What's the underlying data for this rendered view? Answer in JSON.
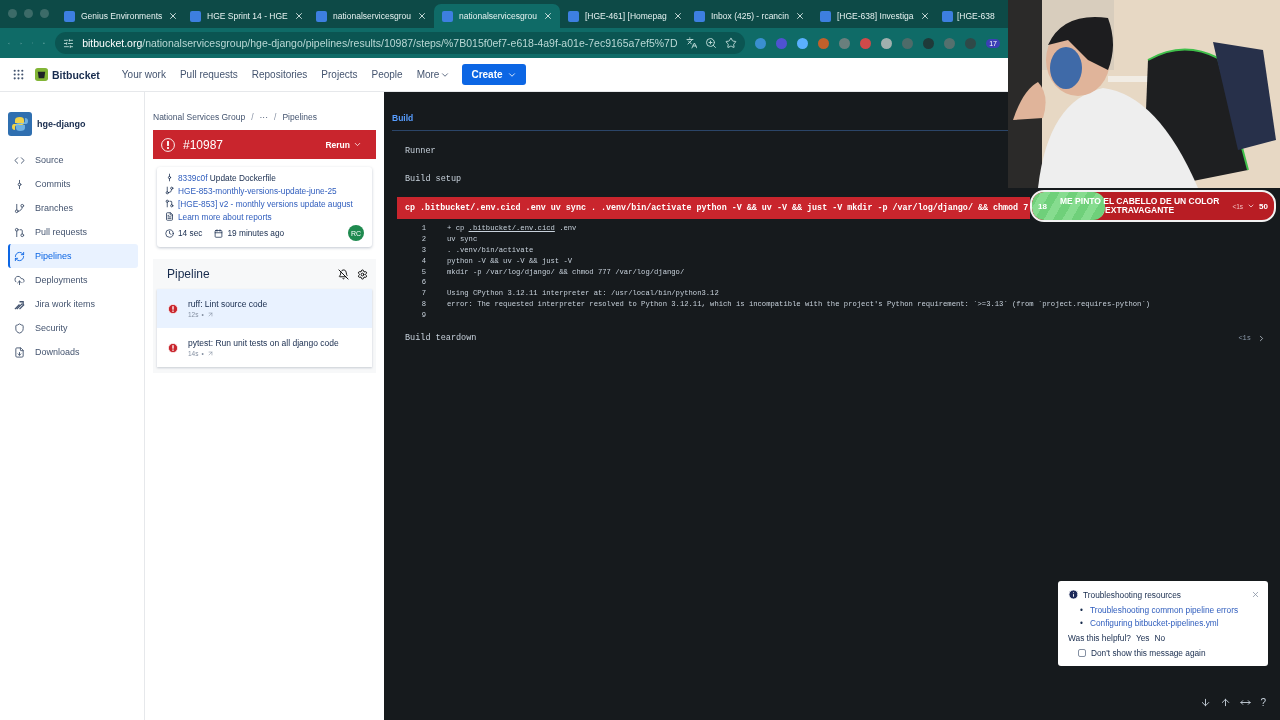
{
  "browser": {
    "tabs": [
      {
        "title": "Genius Environments",
        "selected": false
      },
      {
        "title": "HGE Sprint 14 - HGE",
        "selected": false
      },
      {
        "title": "nationalservicesgrou",
        "selected": false
      },
      {
        "title": "nationalservicesgrou",
        "selected": true
      },
      {
        "title": "[HGE-461] [Homepag",
        "selected": false
      },
      {
        "title": "Inbox (425) - rcancin",
        "selected": false
      },
      {
        "title": "[HGE-638] Investiga",
        "selected": false
      },
      {
        "title": "[HGE-638",
        "selected": false
      }
    ],
    "url_host": "bitbucket.org",
    "url_path": "/nationalservicesgroup/hge-django/pipelines/results/10987/steps/%7B015f0ef7-e618-4a9f-a01e-7ec9165a7ef5%7D",
    "extension_badge": "17"
  },
  "header": {
    "product": "Bitbucket",
    "nav": [
      "Your work",
      "Pull requests",
      "Repositories",
      "Projects",
      "People",
      "More"
    ],
    "create": "Create"
  },
  "repo": {
    "name": "hge-django"
  },
  "sidebar": {
    "items": [
      {
        "label": "Source",
        "selected": false
      },
      {
        "label": "Commits",
        "selected": false
      },
      {
        "label": "Branches",
        "selected": false
      },
      {
        "label": "Pull requests",
        "selected": false
      },
      {
        "label": "Pipelines",
        "selected": true
      },
      {
        "label": "Deployments",
        "selected": false
      },
      {
        "label": "Jira work items",
        "selected": false
      },
      {
        "label": "Security",
        "selected": false
      },
      {
        "label": "Downloads",
        "selected": false
      }
    ]
  },
  "breadcrumb": [
    {
      "kind": "link",
      "text": "National Services Group"
    },
    {
      "kind": "separator",
      "text": "/"
    },
    {
      "kind": "link",
      "text": "···"
    },
    {
      "kind": "separator",
      "text": "/"
    },
    {
      "kind": "link",
      "text": "Pipelines"
    }
  ],
  "run": {
    "number": "#10987",
    "failed": true,
    "rerun": "Rerun",
    "commit_hash": "8339c0f",
    "commit_message": "Update Dockerfile",
    "branch": "HGE-853-monthly-versions-update-june-25",
    "pull_request": "[HGE-853] v2 - monthly versions update august",
    "reports_link": "Learn more about reports",
    "duration": "14 sec",
    "time": "19 minutes ago",
    "avatar": "RC"
  },
  "pipeline": {
    "title": "Pipeline",
    "steps": [
      {
        "name": "ruff: Lint source code",
        "duration": "12s",
        "separator": "•",
        "failed": true,
        "selected": true
      },
      {
        "name": "pytest: Run unit tests on all django code",
        "duration": "14s",
        "separator": "•",
        "failed": true,
        "selected": false
      }
    ]
  },
  "log": {
    "tab": "Build",
    "sections": [
      "Runner",
      "Build setup"
    ],
    "command": {
      "text": "cp .bitbucket/.env.cicd .env uv sync . .venv/bin/activate python -V && uv -V && just -V mkdir -p /var/log/django/ && chmod 7",
      "failed": true
    },
    "lines": [
      {
        "number": "1",
        "text": "+ cp ",
        "link": ".bitbucket/.env.cicd",
        "suffix": " .env"
      },
      {
        "number": "2",
        "text": "uv sync"
      },
      {
        "number": "3",
        "text": ". .venv/bin/activate"
      },
      {
        "number": "4",
        "text": "python -V && uv -V && just -V"
      },
      {
        "number": "5",
        "text": "mkdir -p /var/log/django/ && chmod 777 /var/log/django/"
      },
      {
        "number": "6"
      },
      {
        "number": "7",
        "text": "Using CPython 3.12.11 interpreter at: /usr/local/bin/python3.12"
      },
      {
        "number": "8",
        "text": "error: The requested interpreter resolved to Python 3.12.11, which is incompatible with the project's Python requirement: `>=3.13` (from `project.requires-python`)"
      },
      {
        "number": "9"
      }
    ],
    "teardown": {
      "title": "Build teardown",
      "duration": "<1s"
    },
    "help": "?"
  },
  "stream_overlay": {
    "start": "18",
    "title": "ME PINTO EL CABELLO DE UN COLOR EXTRAVAGANTE",
    "note": "<1s",
    "end": "50",
    "level": 0.3
  },
  "toast": {
    "title": "Troubleshooting resources",
    "links": [
      {
        "bullet": "•",
        "text": "Troubleshooting common pipeline errors"
      },
      {
        "bullet": "•",
        "text": "Configuring bitbucket-pipelines.yml"
      }
    ],
    "question": "Was this helpful?",
    "yes": "Yes",
    "no": "No",
    "dont_show": {
      "label": "Don't show this message again",
      "checked": false
    }
  }
}
